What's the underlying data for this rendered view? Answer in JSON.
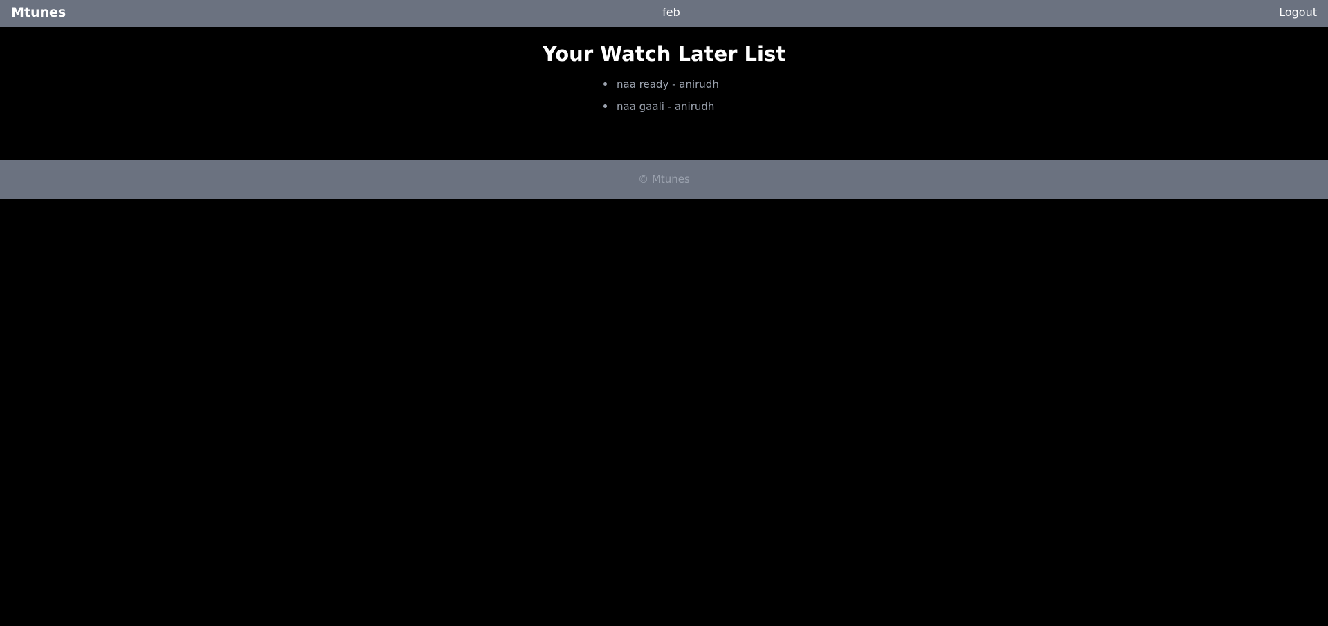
{
  "header": {
    "brand": "Mtunes",
    "username": "feb",
    "logout_label": "Logout"
  },
  "main": {
    "title": "Your Watch Later List",
    "items": [
      {
        "label": "naa ready - anirudh"
      },
      {
        "label": "naa gaali - anirudh"
      }
    ]
  },
  "footer": {
    "copyright": "© Mtunes"
  },
  "colors": {
    "bar_background": "#6b7280",
    "page_background": "#000000",
    "muted_text": "#9ca3af",
    "heading_text": "#ffffff"
  }
}
